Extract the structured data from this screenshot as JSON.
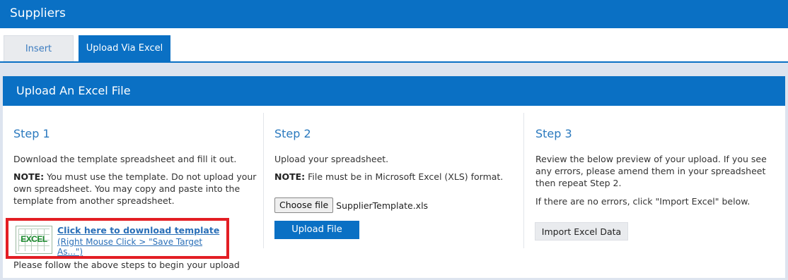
{
  "header": {
    "title": "Suppliers"
  },
  "tabs": [
    {
      "label": "Insert"
    },
    {
      "label": "Upload Via Excel"
    }
  ],
  "panel": {
    "title": "Upload An Excel File"
  },
  "step1": {
    "title": "Step 1",
    "text": "Download the template spreadsheet and fill it out.",
    "note_label": "NOTE:",
    "note_text": " You must use the template. Do not upload your own spreadsheet. You may copy and paste into the template from another spreadsheet.",
    "icon_text": "EXCEL",
    "download_link": "Click here to download template",
    "download_hint": "(Right Mouse Click > \"Save Target As...\")",
    "follow_text": "Please follow the above steps to begin your upload"
  },
  "step2": {
    "title": "Step 2",
    "text": "Upload your spreadsheet.",
    "note_label": "NOTE:",
    "note_text": " File must be in Microsoft Excel (XLS) format.",
    "choose_file_label": "Choose file",
    "file_name": "SupplierTemplate.xls",
    "upload_button": "Upload File"
  },
  "step3": {
    "title": "Step 3",
    "text": "Review the below preview of your upload. If you see any errors, please amend them in your spreadsheet then repeat Step 2.",
    "text2": "If there are no errors, click \"Import Excel\" below.",
    "import_button": "Import Excel Data"
  },
  "colors": {
    "brand_blue": "#0a70c4",
    "highlight_red": "#e31e24",
    "excel_green": "#1a8a2c"
  }
}
